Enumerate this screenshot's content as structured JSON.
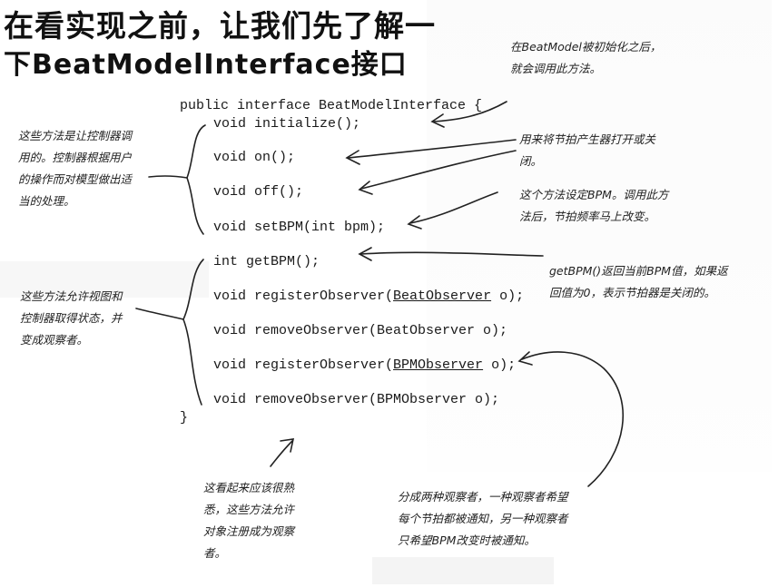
{
  "title": {
    "line1": "在看实现之前，让我们先了解一",
    "line2": "下BeatModelInterface接口"
  },
  "code": {
    "header": "public interface BeatModelInterface {",
    "initialize": "void initialize();",
    "on": "void on();",
    "off": "void off();",
    "setbpm": "void setBPM(int bpm);",
    "getbpm": "int getBPM();",
    "reg_beat_pre": "void registerObserver(",
    "reg_beat_type": "BeatObserver",
    "reg_beat_post": " o);",
    "rem_beat": "void removeObserver(BeatObserver o);",
    "reg_bpm_pre": "void registerObserver(",
    "reg_bpm_type": "BPMObserver",
    "reg_bpm_post": " o);",
    "rem_bpm": "void removeObserver(BPMObserver o);",
    "close": "}"
  },
  "notes": {
    "init": [
      "在BeatModel被初始化之后，",
      "就会调用此方法。"
    ],
    "onoff": [
      "用来将节拍产生器打开或关",
      "闭。"
    ],
    "setbpm": [
      "这个方法设定BPM。调用此方",
      "法后，节拍频率马上改变。"
    ],
    "getbpm": [
      "getBPM()返回当前BPM值，如果返",
      "回值为0，表示节拍器是关闭的。"
    ],
    "controller": [
      "这些方法是让控制器调",
      "用的。控制器根据用户",
      "的操作而对模型做出适",
      "当的处理。"
    ],
    "view": [
      "这些方法允许视图和",
      "控制器取得状态，并",
      "变成观察者。"
    ],
    "familiar": [
      "这看起来应该很熟",
      "悉，这些方法允许",
      "对象注册成为观察",
      "者。"
    ],
    "observers": [
      "分成两种观察者，一种观察者希望",
      "每个节拍都被通知，另一种观察者",
      "只希望BPM改变时被通知。"
    ]
  }
}
